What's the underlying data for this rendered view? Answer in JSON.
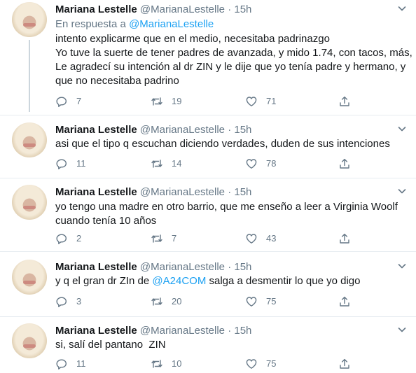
{
  "tweets": [
    {
      "name": "Mariana Lestelle",
      "handle": "@MarianaLestelle",
      "dot": "·",
      "time": "15h",
      "reply_prefix": "En respuesta a",
      "reply_handle": "@MarianaLestelle",
      "lines": [
        "intento explicarme que en el medio, necesitaba padrinazgo",
        "Yo tuve la suerte de tener padres de avanzada, y mido 1.74, con tacos, más,",
        "Le agradecí su intención al dr ZIN y le dije que yo tenía padre y hermano, y",
        "que no necesitaba padrino"
      ],
      "replies": "7",
      "retweets": "19",
      "likes": "71"
    },
    {
      "name": "Mariana Lestelle",
      "handle": "@MarianaLestelle",
      "dot": "·",
      "time": "15h",
      "lines": [
        "asi que el tipo q escuchan diciendo verdades, duden de sus intenciones"
      ],
      "replies": "11",
      "retweets": "14",
      "likes": "78"
    },
    {
      "name": "Mariana Lestelle",
      "handle": "@MarianaLestelle",
      "dot": "·",
      "time": "15h",
      "lines": [
        "yo tengo una madre en otro barrio, que me enseño a leer a Virginia Woolf",
        "cuando tenía 10 años"
      ],
      "replies": "2",
      "retweets": "7",
      "likes": "43"
    },
    {
      "name": "Mariana Lestelle",
      "handle": "@MarianaLestelle",
      "dot": "·",
      "time": "15h",
      "text_before": "y q el gran dr ZIn de ",
      "mention": "@A24COM",
      "text_after": " salga a desmentir lo que yo digo",
      "replies": "3",
      "retweets": "20",
      "likes": "75"
    },
    {
      "name": "Mariana Lestelle",
      "handle": "@MarianaLestelle",
      "dot": "·",
      "time": "15h",
      "lines": [
        "si, salí del pantano  ZIN"
      ],
      "replies": "11",
      "retweets": "10",
      "likes": "75"
    }
  ],
  "icons": {
    "reply": "reply-icon",
    "retweet": "retweet-icon",
    "like": "heart-icon",
    "share": "share-icon",
    "more": "chevron-down-icon"
  },
  "colors": {
    "link": "#1da1f2",
    "muted": "#657786",
    "text": "#14171a",
    "divider": "#e6ecf0"
  }
}
